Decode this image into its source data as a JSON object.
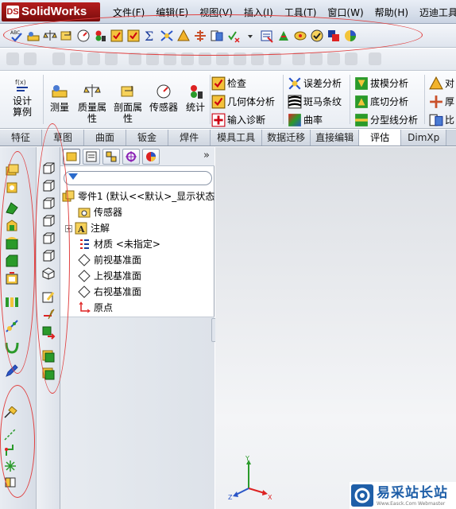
{
  "app": {
    "logo_text": "SolidWorks",
    "logo_badge": "DS"
  },
  "menu": [
    "文件(F)",
    "编辑(E)",
    "视图(V)",
    "插入(I)",
    "工具(T)",
    "窗口(W)",
    "帮助(H)",
    "迈迪工具"
  ],
  "ribbon": {
    "design_calc": "设计算例",
    "measure": "测量",
    "mass_props": "质量属性",
    "section_props": "剖面属性",
    "sensor": "传感器",
    "statistics": "统计",
    "check": "检查",
    "geometry_analysis": "几何体分析",
    "import_diagnostics": "输入诊断",
    "deviation_analysis": "误差分析",
    "zebra_stripes": "斑马条纹",
    "curvature": "曲率",
    "draft_analysis": "拔模分析",
    "undercut_analysis": "底切分析",
    "parting_line_analysis": "分型线分析",
    "cut_right_1": "对",
    "cut_right_2": "厚",
    "cut_right_3": "比"
  },
  "tabs": [
    "特征",
    "草图",
    "曲面",
    "钣金",
    "焊件",
    "模具工具",
    "数据迁移",
    "直接编辑",
    "评估",
    "DimXp"
  ],
  "active_tab": "评估",
  "feature_tree": {
    "more": "»",
    "part": "零件1 (默认<<默认>_显示状态",
    "sensors": "传感器",
    "annotations": "注解",
    "material": "材质 <未指定>",
    "front_plane": "前视基准面",
    "top_plane": "上视基准面",
    "right_plane": "右视基准面",
    "origin": "原点",
    "expand_symbol": "+"
  },
  "triad": {
    "x": "X",
    "y": "Y",
    "z": "Z"
  },
  "watermark": {
    "title": "易采站长站",
    "subtitle": "Www.Easck.Com Webmaster"
  },
  "colors": {
    "accent": "#1f5fa8",
    "logo": "#b51d1d",
    "annotation_red": "#e04040"
  }
}
